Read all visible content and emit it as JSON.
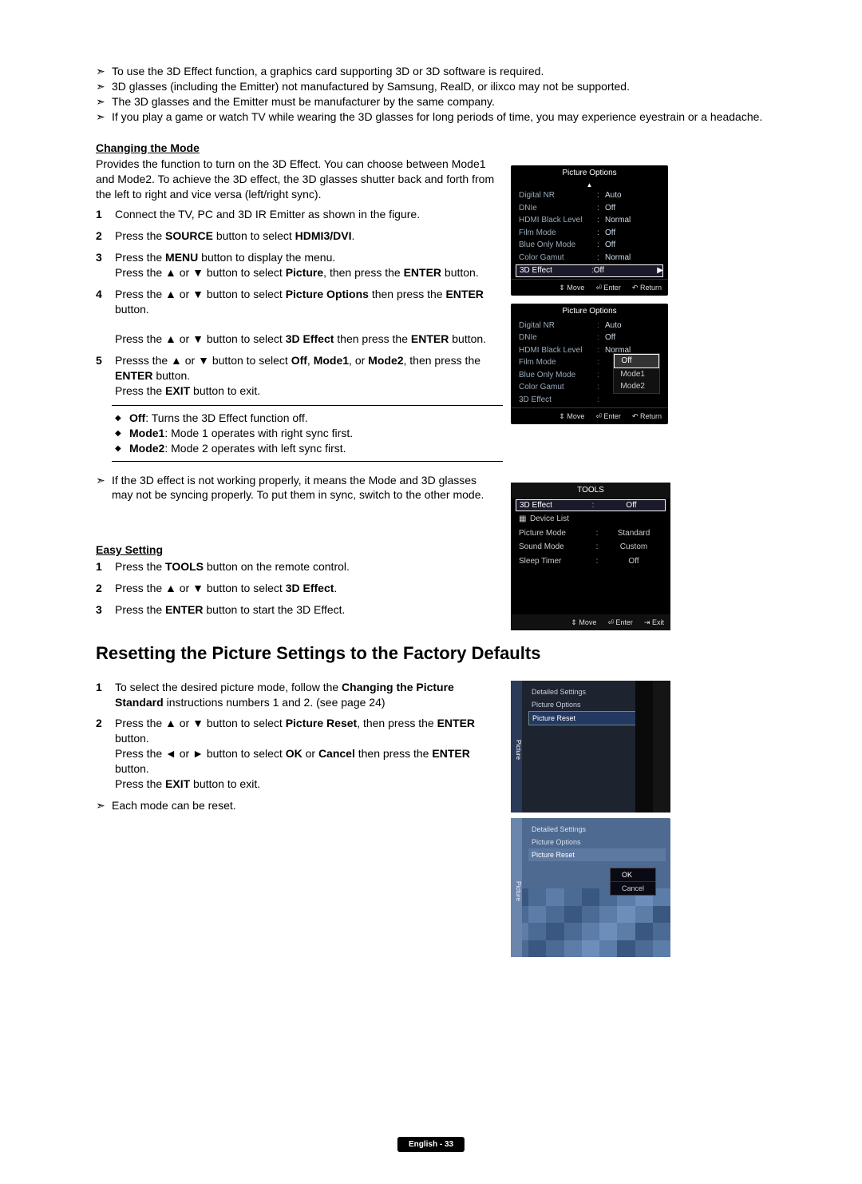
{
  "intro_bullets": [
    "To use the 3D Effect function, a graphics card supporting 3D or 3D software is required.",
    "3D glasses (including the Emitter) not manufactured by Samsung, RealD, or ilixco may not be supported.",
    "The 3D glasses and the Emitter must be manufacturer by the same company.",
    "If you play a game or watch TV while wearing the 3D glasses for long periods of time, you may experience eyestrain or a headache."
  ],
  "changing_mode": {
    "title": "Changing the Mode",
    "desc": "Provides the function to turn on the 3D Effect. You can choose between Mode1 and Mode2. To achieve the 3D effect, the 3D glasses shutter back and forth from the left to right and vice versa (left/right sync).",
    "steps": [
      "Connect the TV, PC and 3D IR Emitter as shown in the figure.",
      "Press the <b>SOURCE</b> button to select <b>HDMI3/DVI</b>.",
      "Press the <b>MENU</b> button to display the menu.<br>Press the ▲ or ▼ button to select <b>Picture</b>, then press the <b>ENTER</b> button.",
      "Press the ▲ or ▼ button to select <b>Picture Options</b> then press the <b>ENTER</b> button.<br><br>Press the ▲ or ▼ button to select <b>3D Effect</b> then press the <b>ENTER</b> button.",
      "Presss the ▲ or ▼ button to select <b>Off</b>, <b>Mode1</b>, or <b>Mode2</b>, then press the <b>ENTER</b> button.<br>Press the <b>EXIT</b> button to exit."
    ],
    "options": [
      "<b>Off</b>: Turns the 3D Effect function off.",
      "<b>Mode1</b>: Mode 1 operates with right sync first.",
      "<b>Mode2</b>: Mode 2 operates with left sync first."
    ],
    "note": "If the 3D effect is not working properly, it means the Mode and 3D glasses may not be syncing properly. To put them in sync, switch to the other mode."
  },
  "easy_setting": {
    "title": "Easy Setting",
    "steps": [
      "Press the <b>TOOLS</b> button on the remote control.",
      "Press the ▲ or ▼ button to select <b>3D Effect</b>.",
      "Press the <b>ENTER</b> button to start the 3D Effect."
    ]
  },
  "resetting": {
    "heading": "Resetting the Picture Settings to the Factory Defaults",
    "steps": [
      "To select the desired picture mode, follow the <b>Changing the Picture Standard</b> instructions numbers 1 and 2. (see page 24)",
      "Press the ▲ or ▼ button to select <b>Picture Reset</b>, then press the <b>ENTER</b> button.<br>Press the ◄ or ► button to select <b>OK</b> or <b>Cancel</b> then press the <b>ENTER</b> button.<br>Press the <b>EXIT</b> button to exit."
    ],
    "note": "Each mode can be reset."
  },
  "osd1": {
    "title": "Picture Options",
    "rows": [
      {
        "lab": "Digital NR",
        "val": "Auto"
      },
      {
        "lab": "DNIe",
        "val": "Off"
      },
      {
        "lab": "HDMI Black Level",
        "val": "Normal"
      },
      {
        "lab": "Film Mode",
        "val": "Off"
      },
      {
        "lab": "Blue Only Mode",
        "val": "Off"
      },
      {
        "lab": "Color Gamut",
        "val": "Normal"
      }
    ],
    "highlight": {
      "lab": "3D Effect",
      "val": "Off"
    },
    "footer": [
      "Move",
      "Enter",
      "Return"
    ]
  },
  "osd2": {
    "title": "Picture Options",
    "rows": [
      {
        "lab": "Digital NR",
        "val": "Auto"
      },
      {
        "lab": "DNIe",
        "val": "Off"
      },
      {
        "lab": "HDMI Black Level",
        "val": "Normal"
      },
      {
        "lab": "Film Mode",
        "val": ""
      },
      {
        "lab": "Blue Only Mode",
        "val": ""
      },
      {
        "lab": "Color Gamut",
        "val": ""
      },
      {
        "lab": "3D Effect",
        "val": ""
      }
    ],
    "popup": [
      "Off",
      "Mode1",
      "Mode2"
    ],
    "footer": [
      "Move",
      "Enter",
      "Return"
    ]
  },
  "osd3": {
    "title": "TOOLS",
    "highlight": {
      "lab": "3D Effect",
      "val": "Off"
    },
    "rows": [
      {
        "lab": "Device List",
        "sep": "",
        "val": ""
      },
      {
        "lab": "Picture Mode",
        "sep": ":",
        "val": "Standard"
      },
      {
        "lab": "Sound Mode",
        "sep": ":",
        "val": "Custom"
      },
      {
        "lab": "Sleep Timer",
        "sep": ":",
        "val": "Off"
      }
    ],
    "footer": [
      "Move",
      "Enter",
      "Exit"
    ]
  },
  "osd4": {
    "sidebar": "Picture",
    "rows": [
      "Detailed Settings",
      "Picture Options"
    ],
    "sel": "Picture Reset",
    "marker": "▶"
  },
  "osd5": {
    "sidebar": "Picture",
    "rows": [
      "Detailed Settings",
      "Picture Options",
      "Picture Reset"
    ],
    "popup": [
      "OK",
      "Cancel"
    ]
  },
  "page_footer": "English - 33",
  "icons": {
    "move": "⇕",
    "enter": "⏎",
    "return": "↶",
    "exit": "⇥",
    "anynet": "▦"
  }
}
